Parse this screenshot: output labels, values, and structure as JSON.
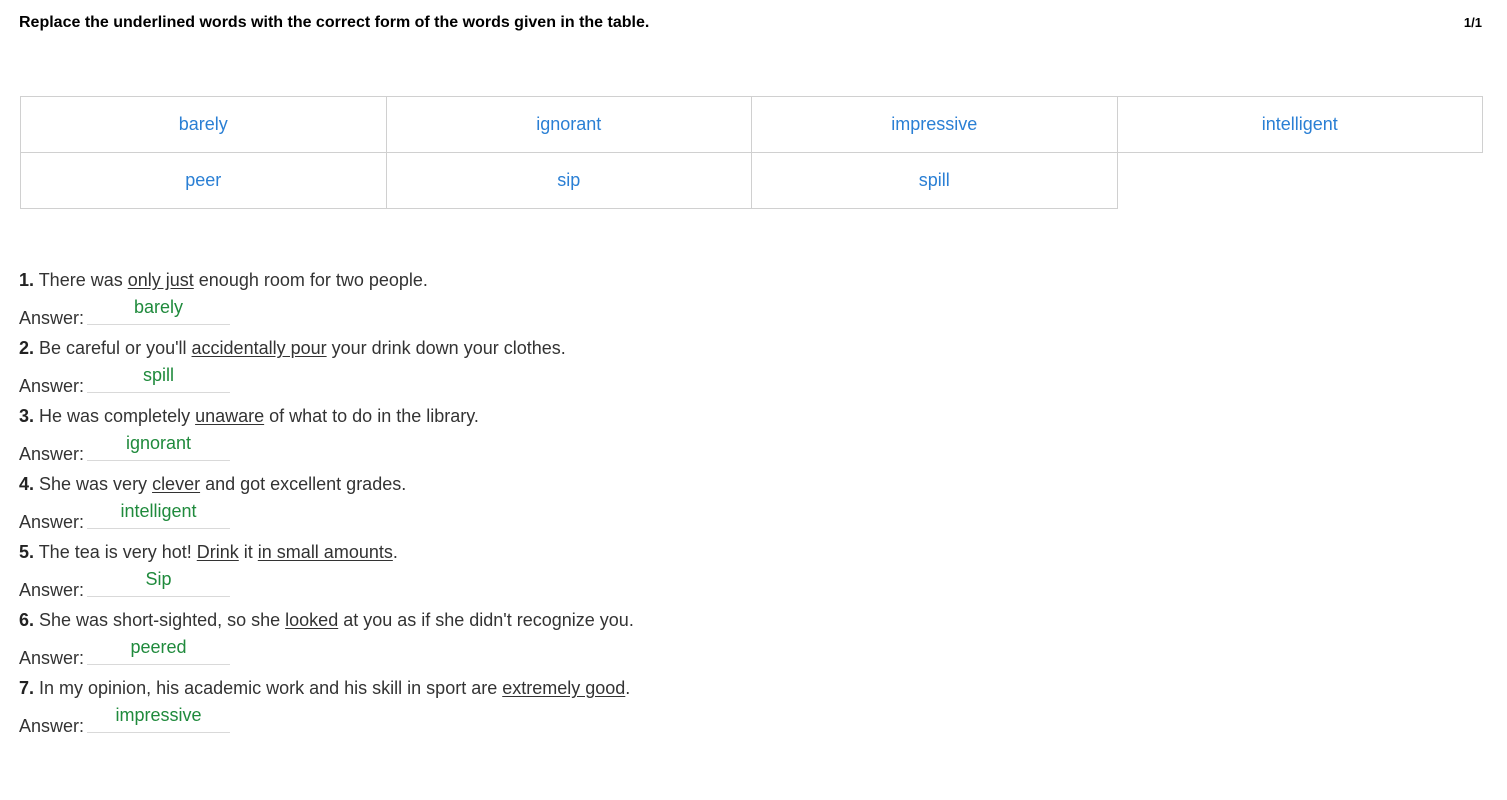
{
  "header": {
    "instruction": "Replace the underlined words with the correct form of the words given in the table.",
    "page_count": "1/1"
  },
  "word_bank": [
    "barely",
    "ignorant",
    "impressive",
    "intelligent",
    "peer",
    "sip",
    "spill"
  ],
  "answer_label": "Answer:",
  "questions": [
    {
      "number": "1.",
      "parts": [
        " There was ",
        "only just",
        " enough room for two people."
      ],
      "answer": "barely"
    },
    {
      "number": "2.",
      "parts": [
        " Be careful or you'll ",
        "accidentally pour",
        " your drink down your clothes."
      ],
      "answer": "spill"
    },
    {
      "number": "3.",
      "parts": [
        " He was completely ",
        "unaware",
        " of what to do in the library."
      ],
      "answer": "ignorant"
    },
    {
      "number": "4.",
      "parts": [
        " She was very ",
        "clever",
        " and got excellent grades."
      ],
      "answer": "intelligent"
    },
    {
      "number": "5.",
      "parts": [
        " The tea is very hot! ",
        "Drink",
        " it ",
        "in small amounts",
        "."
      ],
      "answer": "Sip"
    },
    {
      "number": "6.",
      "parts": [
        " She was short-sighted, so she ",
        "looked",
        " at you as if she didn't recognize you."
      ],
      "answer": "peered"
    },
    {
      "number": "7.",
      "parts": [
        " In my opinion, his academic work and his skill in sport are ",
        "extremely good",
        "."
      ],
      "answer": "impressive"
    }
  ]
}
